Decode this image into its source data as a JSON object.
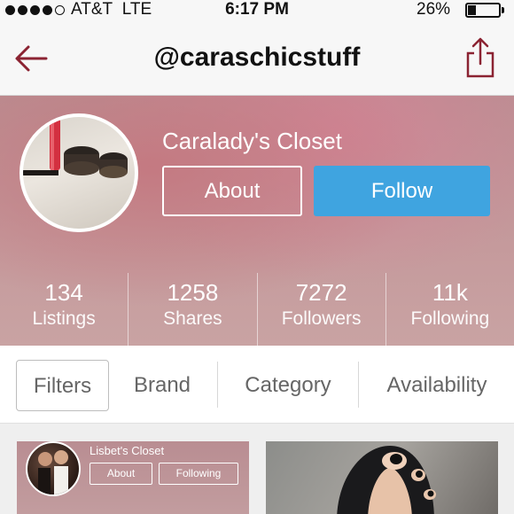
{
  "status_bar": {
    "carrier": "AT&T",
    "network": "LTE",
    "time": "6:17 PM",
    "battery": "26%",
    "battery_level": 0.26,
    "signal_bars": 4,
    "signal_total": 5
  },
  "nav": {
    "title": "@caraschicstuff",
    "back_icon": "back-arrow-icon",
    "share_icon": "share-icon"
  },
  "profile": {
    "closet_name": "Caralady's Closet",
    "about_label": "About",
    "follow_label": "Follow",
    "stats": [
      {
        "value": "134",
        "label": "Listings"
      },
      {
        "value": "1258",
        "label": "Shares"
      },
      {
        "value": "7272",
        "label": "Followers"
      },
      {
        "value": "11k",
        "label": "Following"
      }
    ]
  },
  "filters": {
    "tabs": [
      {
        "label": "Filters"
      },
      {
        "label": "Brand"
      },
      {
        "label": "Category"
      },
      {
        "label": "Availability"
      }
    ]
  },
  "grid": {
    "tiles": [
      {
        "closet_name": "Lisbet's Closet",
        "about_label": "About",
        "following_label": "Following"
      }
    ]
  },
  "colors": {
    "accent": "#3fa4e0",
    "brand": "#8b2332",
    "header_tint": "#c49a9c"
  }
}
